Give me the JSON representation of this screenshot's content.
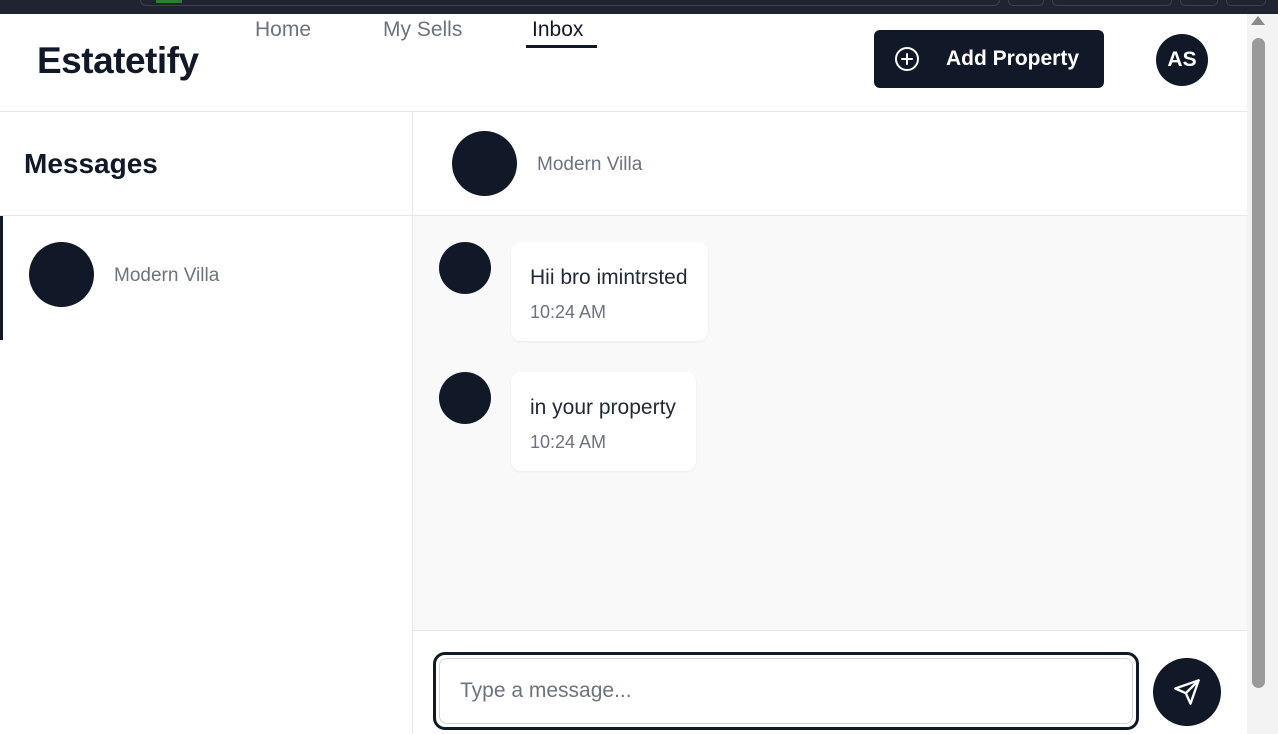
{
  "app": {
    "brand": "Estatetify"
  },
  "nav": {
    "items": [
      {
        "label": "Home",
        "active": false
      },
      {
        "label": "My Sells",
        "active": false
      },
      {
        "label": "Inbox",
        "active": true
      }
    ]
  },
  "header": {
    "add_property_label": "Add Property",
    "user_initials": "AS"
  },
  "sidebar": {
    "title": "Messages",
    "conversations": [
      {
        "name": "Modern Villa",
        "selected": true
      }
    ]
  },
  "chat": {
    "title": "Modern Villa",
    "messages": [
      {
        "text": "Hii bro imintrsted",
        "time": "10:24 AM"
      },
      {
        "text": "in your property",
        "time": "10:24 AM"
      }
    ],
    "composer": {
      "placeholder": "Type a message...",
      "value": ""
    }
  },
  "icons": {
    "add": "plus-circle-icon",
    "send": "send-icon"
  },
  "colors": {
    "primary": "#111827",
    "muted_text": "#6b7280",
    "chat_background": "#f9f9f9"
  }
}
